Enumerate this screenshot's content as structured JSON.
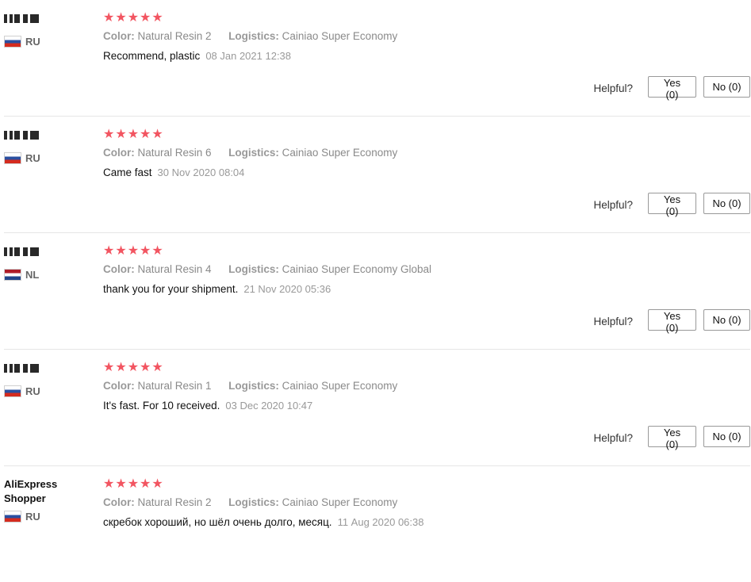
{
  "labels": {
    "color": "Color:",
    "logistics": "Logistics:",
    "helpful": "Helpful?",
    "stars": "★★★★★"
  },
  "colors": {
    "star": "#f25561",
    "meta_text": "#8a8a8a",
    "divider": "#e6e6e6"
  },
  "reviews": [
    {
      "user_name": "",
      "country": "RU",
      "rating": 5,
      "color": "Natural Resin 2",
      "logistics": "Cainiao Super Economy",
      "text": "Recommend, plastic",
      "date": "08 Jan 2021 12:38",
      "yes": "Yes (0)",
      "no": "No (0)"
    },
    {
      "user_name": "",
      "country": "RU",
      "rating": 5,
      "color": "Natural Resin 6",
      "logistics": "Cainiao Super Economy",
      "text": "Came fast",
      "date": "30 Nov 2020 08:04",
      "yes": "Yes (0)",
      "no": "No (0)"
    },
    {
      "user_name": "",
      "country": "NL",
      "rating": 5,
      "color": "Natural Resin 4",
      "logistics": "Cainiao Super Economy Global",
      "text": "thank you for your shipment.",
      "date": "21 Nov 2020 05:36",
      "yes": "Yes (0)",
      "no": "No (0)"
    },
    {
      "user_name": "",
      "country": "RU",
      "rating": 5,
      "color": "Natural Resin 1",
      "logistics": "Cainiao Super Economy",
      "text": "It's fast. For 10 received.",
      "date": "03 Dec 2020 10:47",
      "yes": "Yes (0)",
      "no": "No (0)"
    },
    {
      "user_name": "AliExpress Shopper",
      "country": "RU",
      "rating": 5,
      "color": "Natural Resin 2",
      "logistics": "Cainiao Super Economy",
      "text": "скребок хороший, но шёл очень долго, месяц.",
      "date": "11 Aug 2020 06:38",
      "yes": "Yes (0)",
      "no": "No (0)"
    }
  ]
}
